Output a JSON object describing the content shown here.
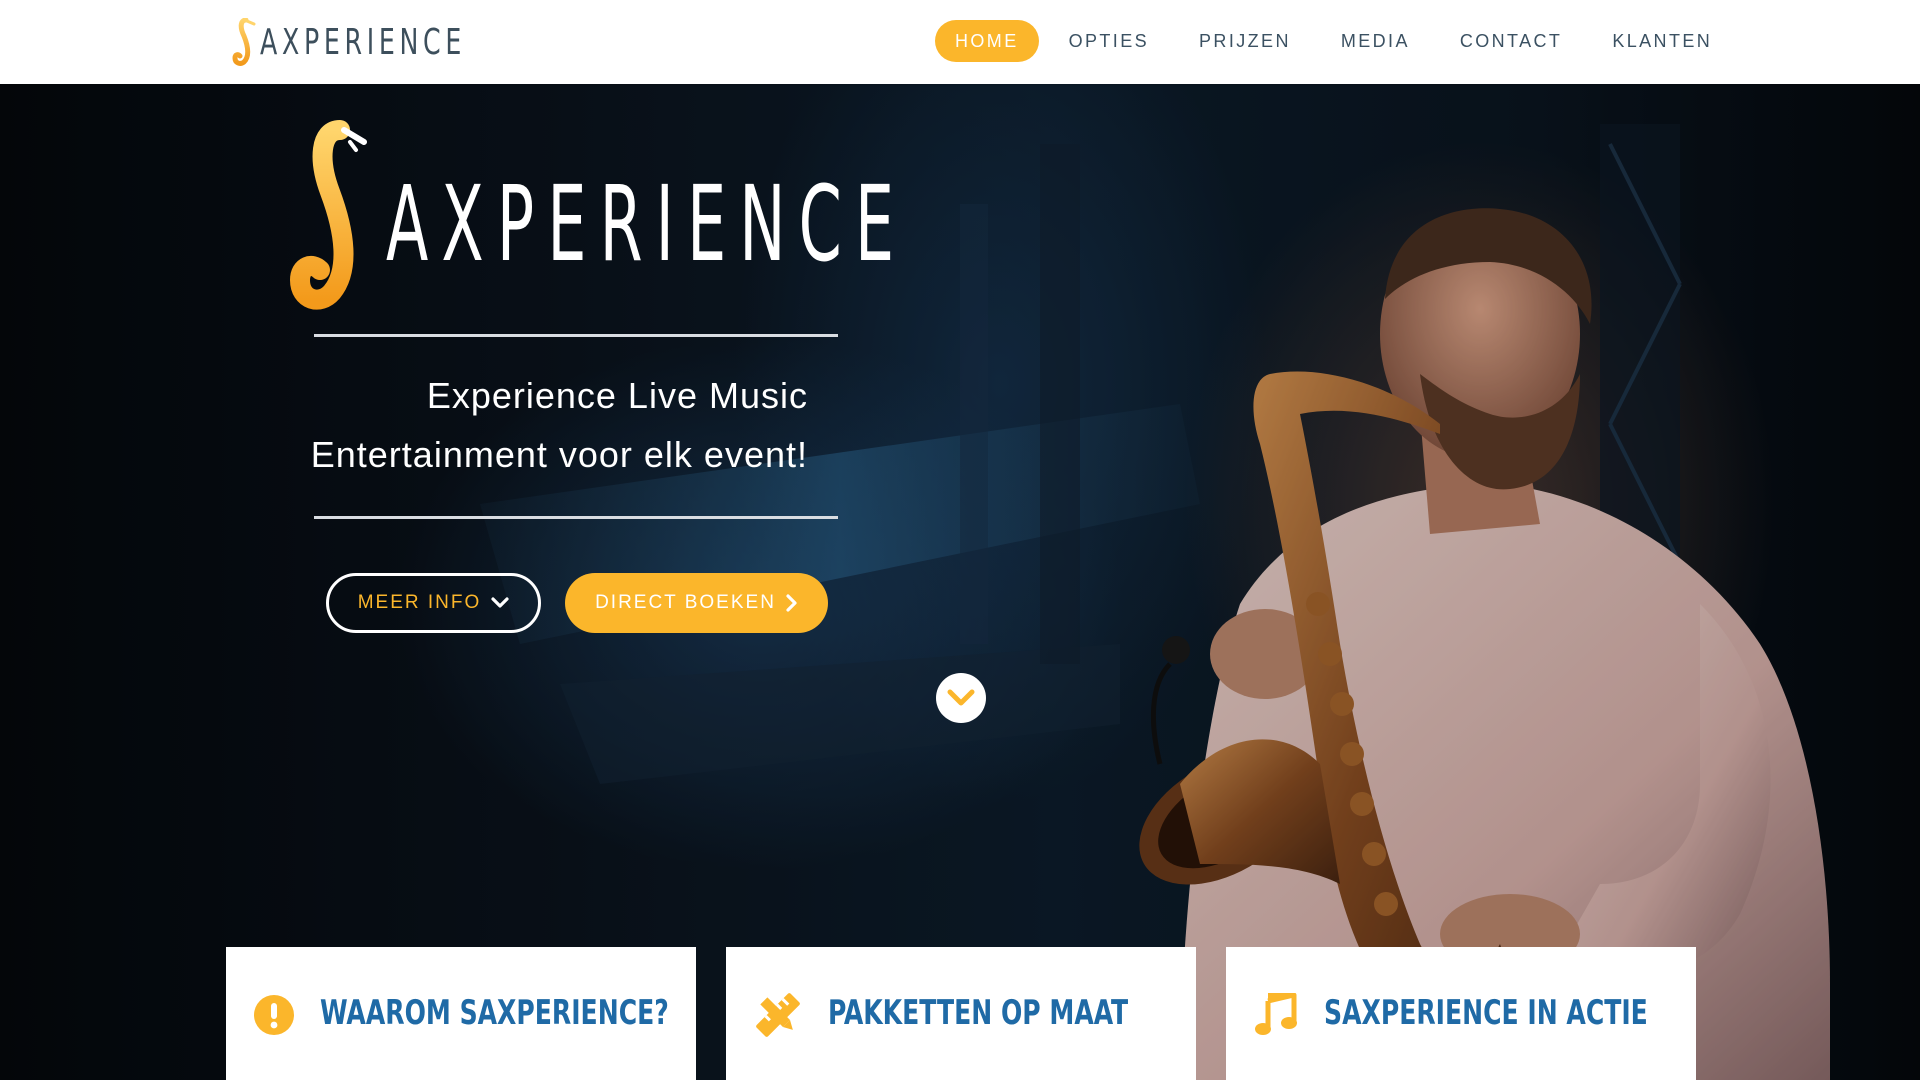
{
  "brand": {
    "name": "AXPERIENCE",
    "accent_color": "#fbb62b",
    "heading_color": "#1f6aa6",
    "nav_text_color": "#3b5162"
  },
  "nav": {
    "items": [
      {
        "label": "HOME",
        "active": true
      },
      {
        "label": "OPTIES",
        "active": false
      },
      {
        "label": "PRIJZEN",
        "active": false
      },
      {
        "label": "MEDIA",
        "active": false
      },
      {
        "label": "CONTACT",
        "active": false
      },
      {
        "label": "KLANTEN",
        "active": false
      }
    ]
  },
  "hero": {
    "title": "AXPERIENCE",
    "tagline_line1": "Experience Live Music",
    "tagline_line2": "Entertainment voor elk event!",
    "btn_more_info": "MEER INFO",
    "btn_more_info_icon": "chevron-down-icon",
    "btn_book": "DIRECT BOEKEN",
    "btn_book_icon": "chevron-right-icon",
    "scroll_icon": "chevron-down-circle-icon"
  },
  "cards": [
    {
      "title": "WAAROM SAXPERIENCE?",
      "icon": "exclamation-circle-icon"
    },
    {
      "title": "PAKKETTEN OP MAAT",
      "icon": "pencil-ruler-icon"
    },
    {
      "title": "SAXPERIENCE IN ACTIE",
      "icon": "music-note-icon"
    }
  ]
}
